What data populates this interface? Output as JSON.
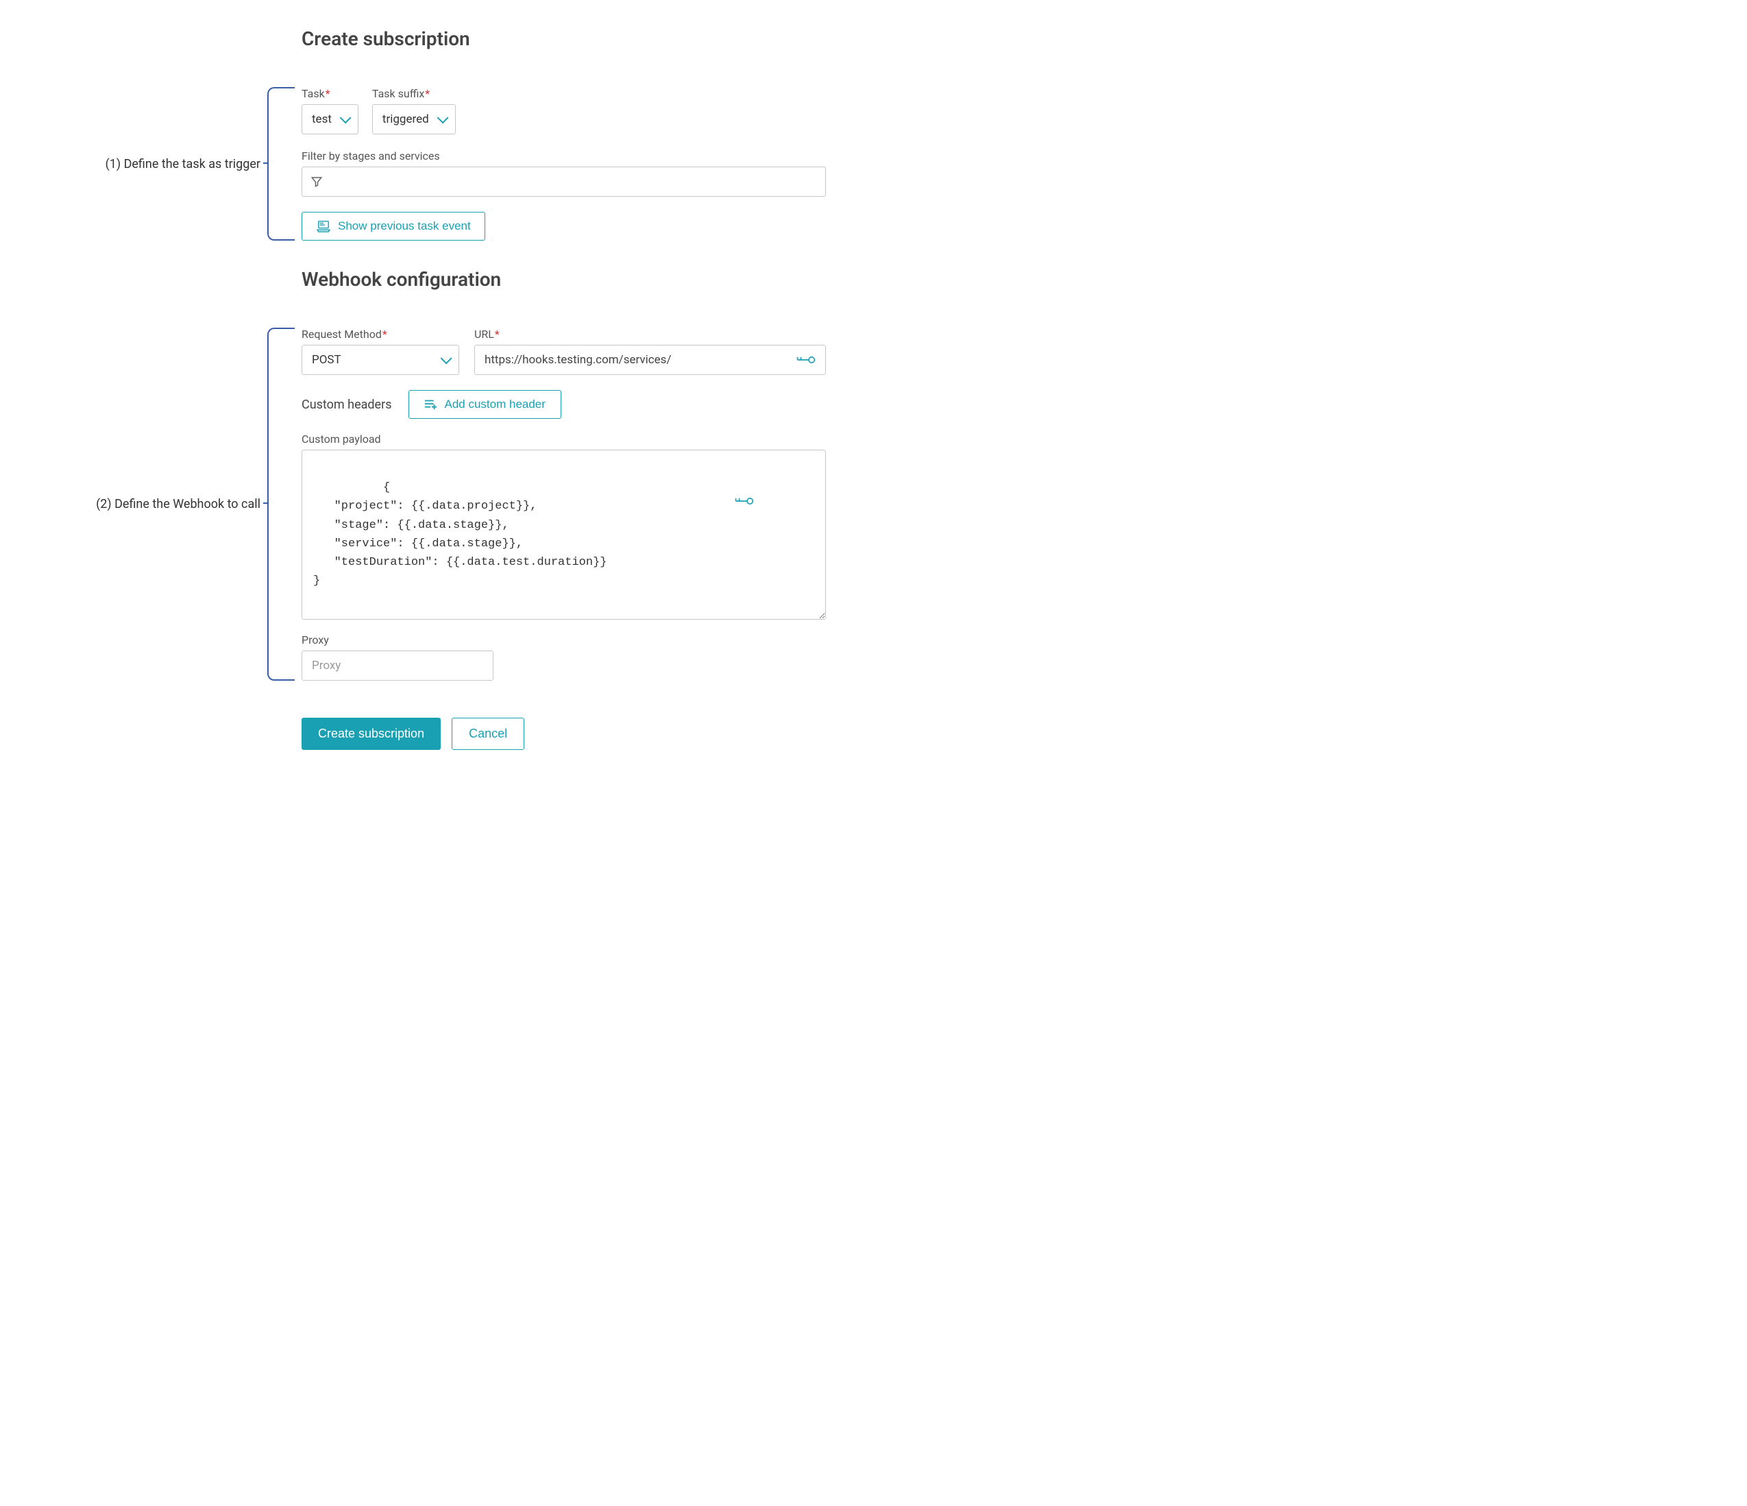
{
  "annotations": {
    "step1": "(1) Define the task as trigger",
    "step2": "(2) Define the Webhook to call"
  },
  "section1": {
    "title": "Create subscription",
    "task_label": "Task",
    "task_value": "test",
    "suffix_label": "Task suffix",
    "suffix_value": "triggered",
    "filter_label": "Filter by stages and services",
    "show_prev_label": "Show previous task event"
  },
  "section2": {
    "title": "Webhook configuration",
    "method_label": "Request Method",
    "method_value": "POST",
    "url_label": "URL",
    "url_value": "https://hooks.testing.com/services/",
    "headers_label": "Custom headers",
    "add_header_label": "Add custom header",
    "payload_label": "Custom payload",
    "payload_value": "{\n   \"project\": {{.data.project}},\n   \"stage\": {{.data.stage}},\n   \"service\": {{.data.stage}},\n   \"testDuration\": {{.data.test.duration}}\n}",
    "proxy_label": "Proxy",
    "proxy_placeholder": "Proxy"
  },
  "buttons": {
    "create": "Create subscription",
    "cancel": "Cancel"
  }
}
